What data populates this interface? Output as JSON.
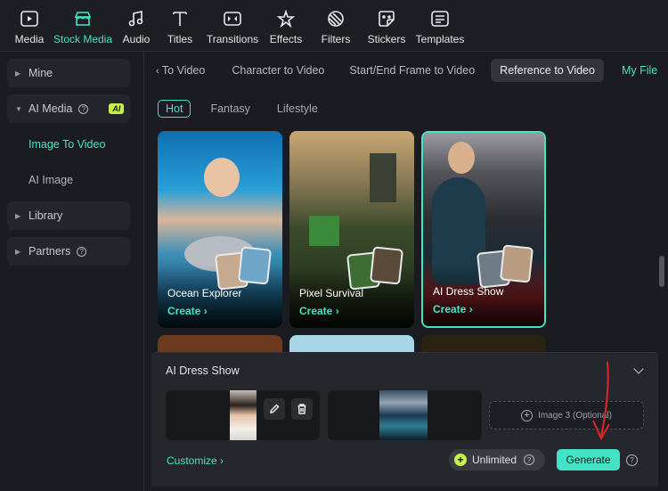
{
  "toolbar": {
    "items": [
      {
        "label": "Media",
        "icon": "media-icon"
      },
      {
        "label": "Stock Media",
        "icon": "stock-media-icon",
        "active": true
      },
      {
        "label": "Audio",
        "icon": "audio-note-icon"
      },
      {
        "label": "Titles",
        "icon": "titles-t-icon"
      },
      {
        "label": "Transitions",
        "icon": "transitions-icon"
      },
      {
        "label": "Effects",
        "icon": "effects-star-icon"
      },
      {
        "label": "Filters",
        "icon": "filters-icon"
      },
      {
        "label": "Stickers",
        "icon": "stickers-icon"
      },
      {
        "label": "Templates",
        "icon": "templates-icon"
      }
    ]
  },
  "sidebar": {
    "mine": "Mine",
    "ai_media": "AI Media",
    "ai_badge": "AI",
    "image_to_video": "Image To Video",
    "ai_image": "AI Image",
    "library": "Library",
    "partners": "Partners"
  },
  "tabs": {
    "items": [
      "To Video",
      "Character to Video",
      "Start/End Frame to Video",
      "Reference to Video",
      "My File"
    ],
    "active": "Reference to Video"
  },
  "chips": [
    "Hot",
    "Fantasy",
    "Lifestyle"
  ],
  "cards": [
    {
      "title": "Ocean Explorer",
      "cta": "Create"
    },
    {
      "title": "Pixel Survival",
      "cta": "Create"
    },
    {
      "title": "AI Dress Show",
      "cta": "Create",
      "selected": true
    }
  ],
  "panel": {
    "title": "AI Dress Show",
    "image3_placeholder": "Image 3 (Optional)",
    "customize": "Customize",
    "unlimited": "Unlimited",
    "generate": "Generate"
  },
  "colors": {
    "accent": "#45e3c5",
    "ai_badge": "#c6f04a",
    "annotation": "#e0242b"
  }
}
